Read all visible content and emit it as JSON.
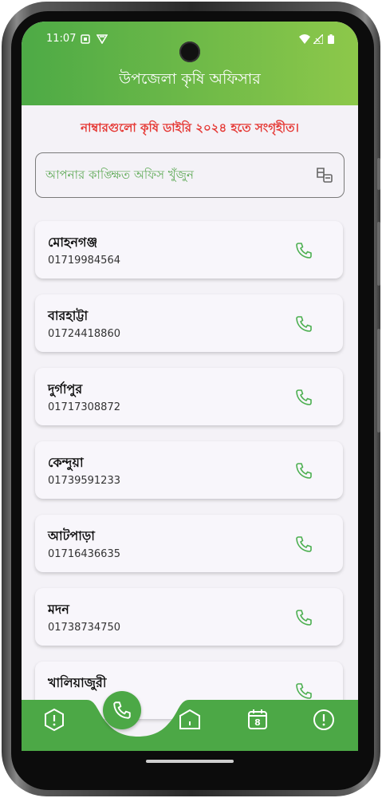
{
  "status_bar": {
    "time": "11:07"
  },
  "app_bar": {
    "title": "উপজেলা কৃষি অফিসার"
  },
  "notice": "নাম্বারগুলো কৃষি ডাইরি ২০২৪ হতে সংগৃহীত।",
  "search": {
    "placeholder": "আপনার কাঙ্ক্ষিত অফিস খুঁজুন",
    "value": "",
    "icon": "filter-icon"
  },
  "contacts": [
    {
      "name": "মোহনগঞ্জ",
      "phone": "01719984564"
    },
    {
      "name": "বারহাট্টা",
      "phone": "01724418860"
    },
    {
      "name": "দুর্গাপুর",
      "phone": "01717308872"
    },
    {
      "name": "কেন্দুয়া",
      "phone": "01739591233"
    },
    {
      "name": "আটপাড়া",
      "phone": "01716436635"
    },
    {
      "name": "মদন",
      "phone": "01738734750"
    },
    {
      "name": "খালিয়াজুরী",
      "phone": ""
    }
  ],
  "bottom_nav": {
    "items": [
      "info-icon",
      "call-icon",
      "home-icon",
      "calendar-icon",
      "alert-icon"
    ],
    "calendar_day": "8",
    "active": "call-icon"
  },
  "colors": {
    "accent": "#4caf50",
    "appbar_start": "#4daa46",
    "appbar_end": "#8dc84a",
    "notice": "#e53935",
    "nav": "#4ca846"
  }
}
